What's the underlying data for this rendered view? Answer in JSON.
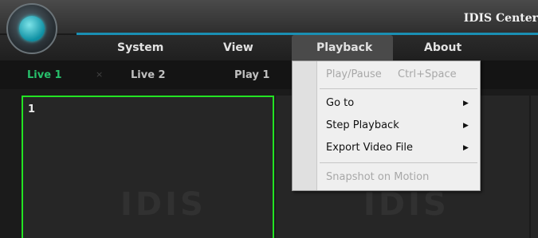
{
  "app": {
    "title": "IDIS Center"
  },
  "menubar": {
    "items": [
      "System",
      "View",
      "Playback",
      "About"
    ]
  },
  "tabs": [
    {
      "label": "Live 1"
    },
    {
      "label": "Live 2"
    },
    {
      "label": "Play 1"
    }
  ],
  "tab_close_glyph": "×",
  "panes": [
    {
      "number": "1",
      "watermark": "IDIS"
    },
    {
      "watermark": "IDIS"
    }
  ],
  "playback_menu": {
    "items": [
      {
        "label": "Play/Pause",
        "shortcut": "Ctrl+Space",
        "enabled": false
      },
      {
        "label": "Go to",
        "submenu": true,
        "enabled": true
      },
      {
        "label": "Step Playback",
        "submenu": true,
        "enabled": true
      },
      {
        "label": "Export Video File",
        "submenu": true,
        "enabled": true
      },
      {
        "label": "Snapshot on Motion",
        "enabled": false
      }
    ],
    "submenu_arrow": "▶"
  },
  "colors": {
    "accent": "#1a8fb3",
    "active_tab": "#27c06b",
    "selected_pane_border": "#23e323"
  }
}
